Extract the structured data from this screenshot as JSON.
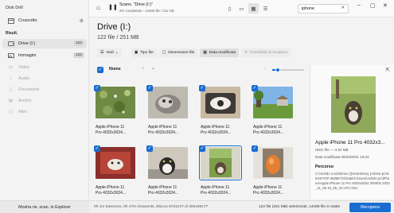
{
  "app": {
    "title": "Disk Drill"
  },
  "sidebar": {
    "items": [
      {
        "label": "Cruscotto"
      },
      {
        "label": "Drive (I:)",
        "count": "122"
      },
      {
        "label": "Immagini",
        "count": "122"
      },
      {
        "label": "Video"
      },
      {
        "label": "Audio"
      },
      {
        "label": "Documenti"
      },
      {
        "label": "Archivi"
      },
      {
        "label": "Altro"
      }
    ],
    "section_label": "Risult.",
    "explorer_button": "Mostra ris. scan. in Explorer"
  },
  "topbar": {
    "scan_title": "Scans. \"Drive (I:)\"",
    "scan_subtitle": "2% completato - 14489 file / 211 GB",
    "search_value": "iphone"
  },
  "main": {
    "title": "Drive (I:)",
    "subtitle": "122 file / 251 MB",
    "filters": [
      "Vedi",
      "Tipo file",
      "Dimensione file",
      "Data modificata",
      "Possibilità di recupero"
    ],
    "name_column": "Nome"
  },
  "tiles": [
    {
      "line1": "Apple iPhone 11",
      "line2": "Pro 4032x3024..."
    },
    {
      "line1": "Apple iPhone 11",
      "line2": "Pro 4032x3024..."
    },
    {
      "line1": "Apple iPhone 11",
      "line2": "Pro 4032x3024..."
    },
    {
      "line1": "Apple iPhone 11",
      "line2": "Pro 4032x3024..."
    },
    {
      "line1": "Apple iPhone 11",
      "line2": "Pro 4032x3024..."
    },
    {
      "line1": "Apple iPhone 11",
      "line2": "Pro 4032x3024..."
    },
    {
      "line1": "Apple iPhone 11",
      "line2": "Pro 4032x3024..."
    },
    {
      "line1": "Apple iPhone 11",
      "line2": "Pro 4032x3024..."
    }
  ],
  "details": {
    "title": "Apple iPhone 11 Pro 4032x3...",
    "meta": "HEIC file — 4.52 MB",
    "date": "Data modificata 08/03/2021 10:03",
    "path_label": "Percorso",
    "path": "C:\\mnt\\dc-s.ssh\\Drive (I)\\Ho\\History (Admin-pc\\DESKTOP-4928KTG\\Data\\C\\Users\\Admin-pc\\iPhone\\Apple iPhone 11 Pro 4032x3024 000002 2024_11_06 10_06_44 UTC.heic"
  },
  "bottombar": {
    "status": "0h 1m trascorso, 0h 47m rimanente, Blocco 5761247 di 305169177",
    "selection": "122 file (251 MB) selezionati, 14489 file in totale",
    "recover": "Recupera"
  },
  "colors": {
    "accent": "#1a6dd1"
  }
}
